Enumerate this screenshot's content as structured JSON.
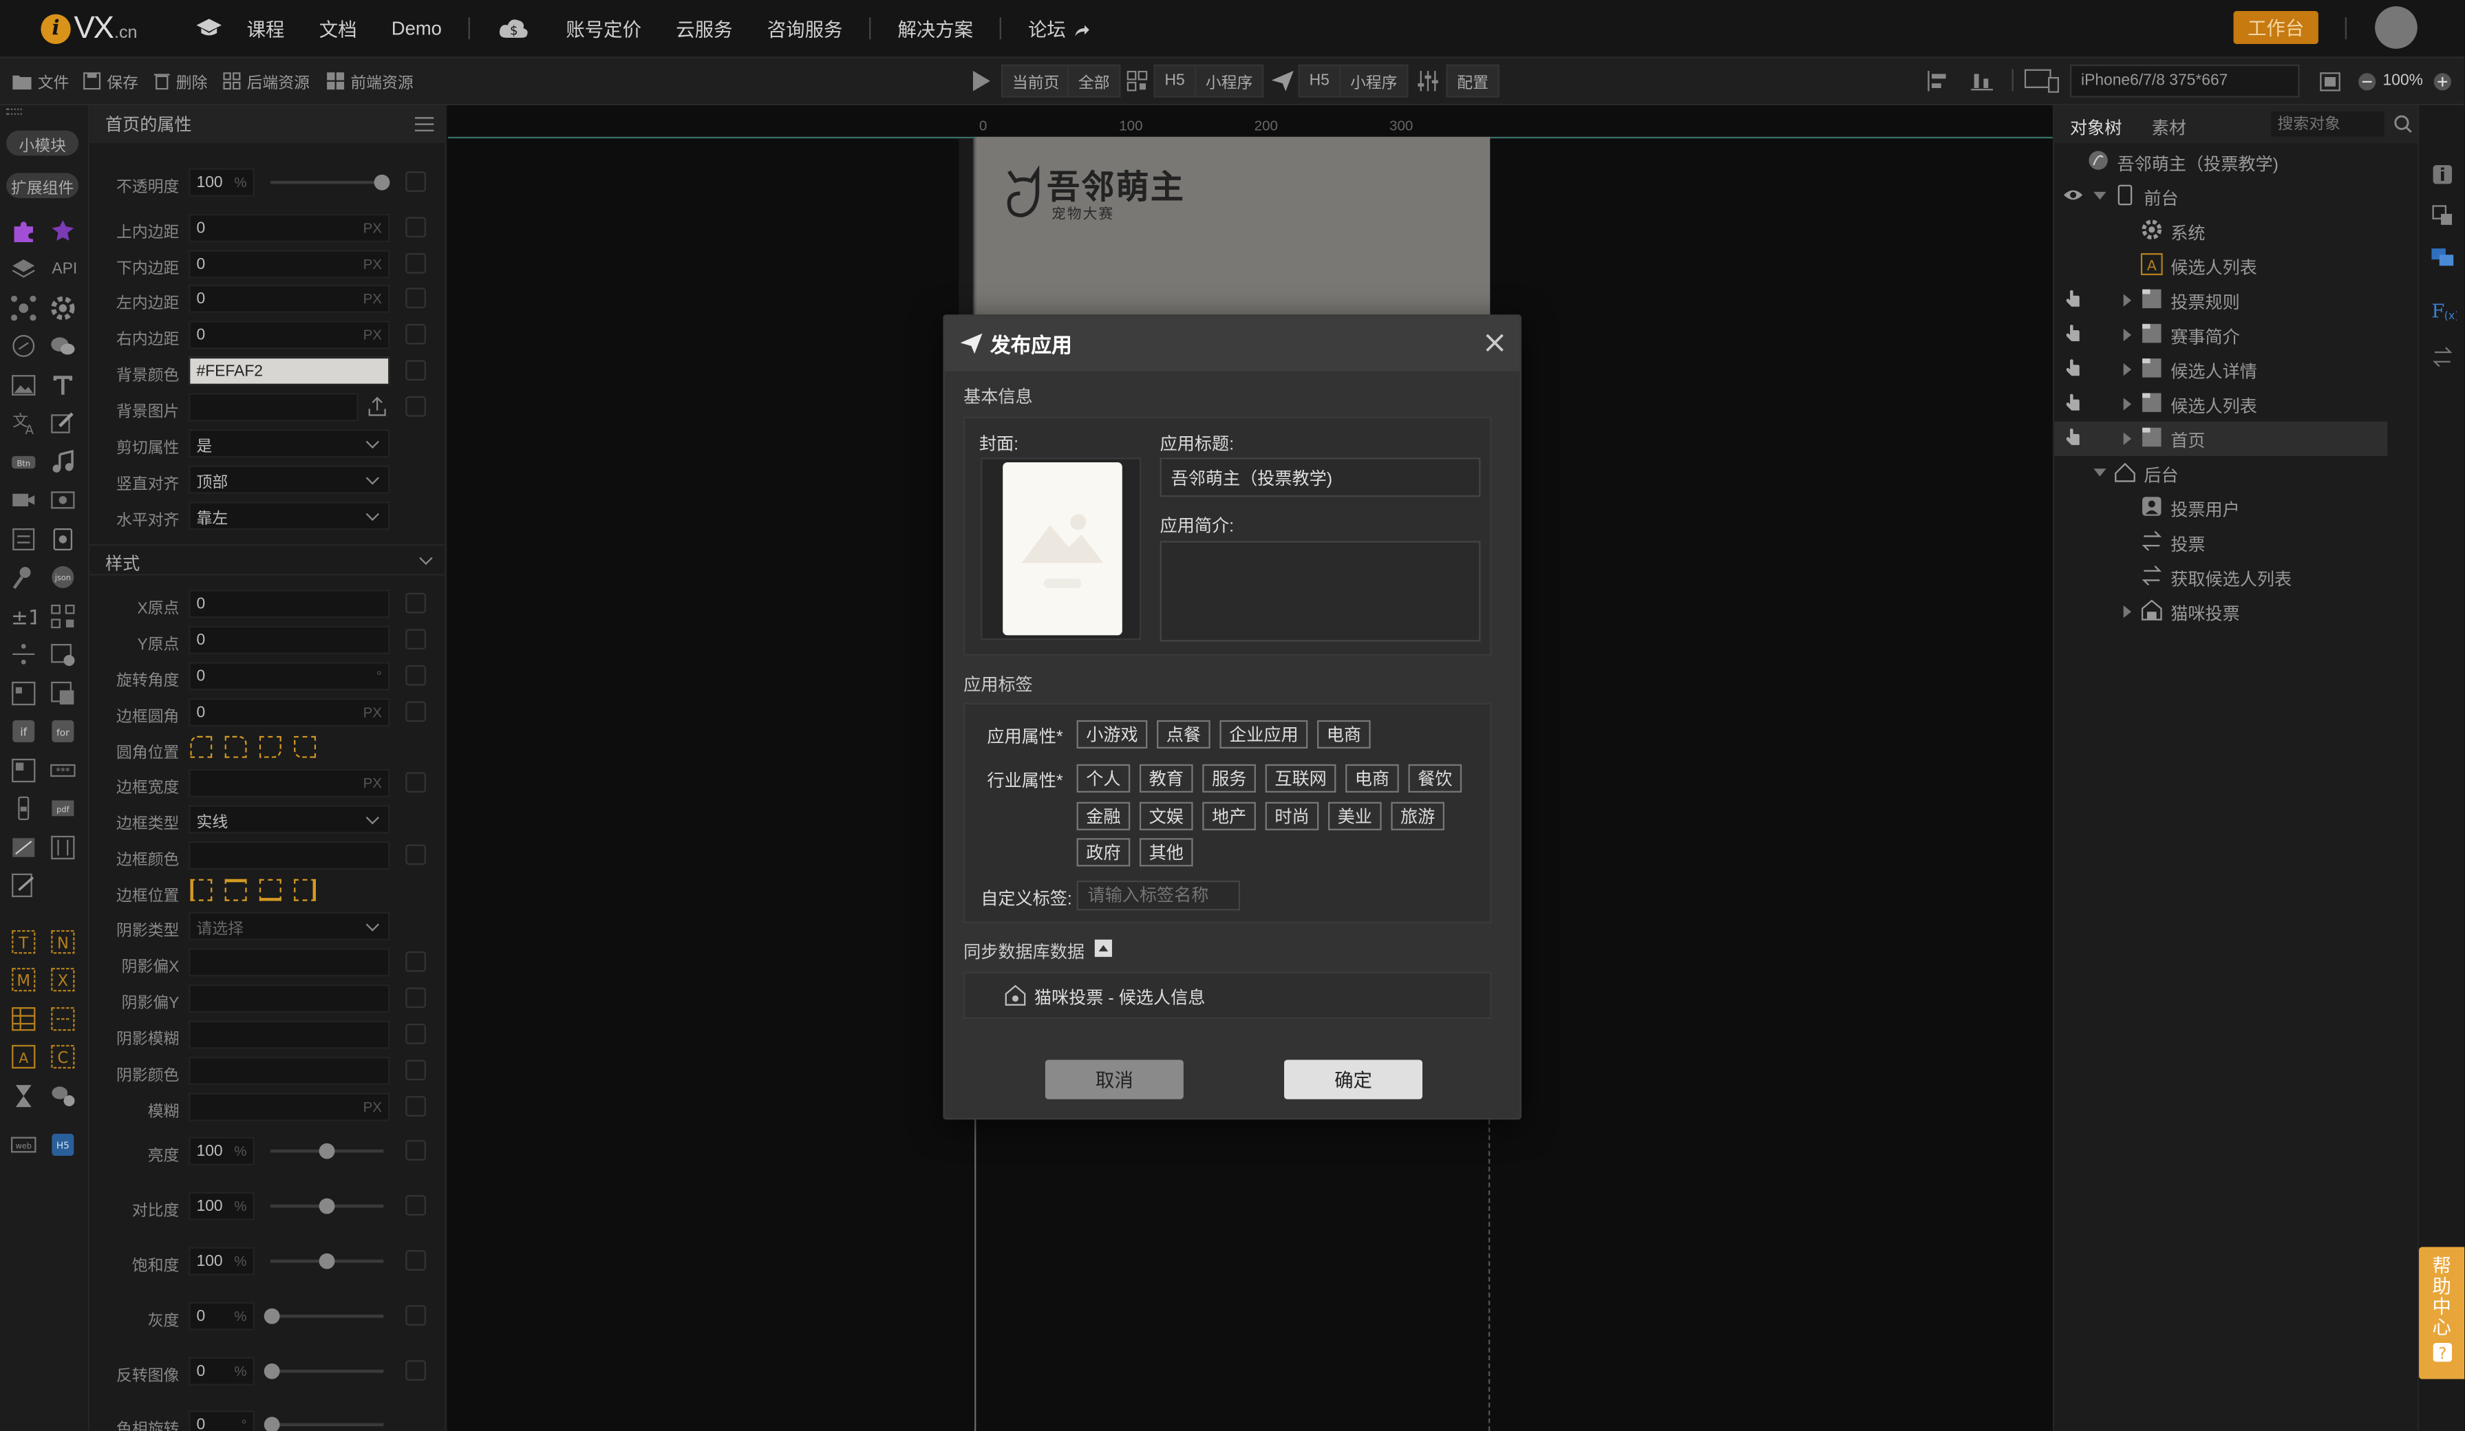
{
  "brand": {
    "i": "i",
    "vx": "VX",
    "cn": ".cn"
  },
  "topnav": {
    "items": [
      "课程",
      "文档",
      "Demo",
      "账号定价",
      "云服务",
      "咨询服务",
      "解决方案",
      "论坛"
    ],
    "workbench": "工作台"
  },
  "toolbar": {
    "file": "文件",
    "save": "保存",
    "delete": "删除",
    "backend": "后端资源",
    "frontend": "前端资源",
    "current_page": "当前页",
    "all": "全部",
    "h5": "H5",
    "mini": "小程序",
    "h5b": "H5",
    "minib": "小程序",
    "config": "配置",
    "device": "iPhone6/7/8 375*667",
    "zoom": "100%"
  },
  "leftstrip": {
    "small_module": "小模块",
    "ext": "扩展组件",
    "api": "API"
  },
  "props": {
    "header": "首页的属性",
    "opacity_label": "不透明度",
    "opacity_value": "100",
    "pct": "%",
    "pad_top": "上内边距",
    "pad_bottom": "下内边距",
    "pad_left": "左内边距",
    "pad_right": "右内边距",
    "zero": "0",
    "px": "PX",
    "bg_color_label": "背景颜色",
    "bg_color": "#FEFAF2",
    "bg_image_label": "背景图片",
    "clip_label": "剪切属性",
    "clip_value": "是",
    "valign_label": "竖直对齐",
    "valign_value": "顶部",
    "halign_label": "水平对齐",
    "halign_value": "靠左",
    "style_section": "样式",
    "x_origin": "X原点",
    "y_origin": "Y原点",
    "rotate": "旋转角度",
    "deg": "°",
    "radius": "边框圆角",
    "radius_pos": "圆角位置",
    "border_width": "边框宽度",
    "border_type": "边框类型",
    "border_type_value": "实线",
    "border_color": "边框颜色",
    "border_pos": "边框位置",
    "shadow_type": "阴影类型",
    "shadow_type_value": "请选择",
    "shadow_x": "阴影偏X",
    "shadow_y": "阴影偏Y",
    "shadow_blur": "阴影模糊",
    "shadow_color": "阴影颜色",
    "blur": "模糊",
    "brightness": "亮度",
    "contrast": "对比度",
    "saturate": "饱和度",
    "gray": "灰度",
    "invert": "反转图像",
    "hue": "色相旋转",
    "v100": "100",
    "v0": "0"
  },
  "ruler": [
    "0",
    "100",
    "200",
    "300"
  ],
  "preview": {
    "title": "吾邻萌主",
    "subtitle": "宠物大赛"
  },
  "rightpanel": {
    "tab_tree": "对象树",
    "tab_assets": "素材",
    "search_placeholder": "搜索对象",
    "nodes": [
      "吾邻萌主（投票教学)",
      "前台",
      "系统",
      "候选人列表",
      "投票规则",
      "赛事简介",
      "候选人详情",
      "候选人列表",
      "首页",
      "后台",
      "投票用户",
      "投票",
      "获取候选人列表",
      "猫咪投票"
    ]
  },
  "help": [
    "帮",
    "助",
    "中",
    "心"
  ],
  "dialog": {
    "title": "发布应用",
    "basic_info": "基本信息",
    "cover_label": "封面:",
    "app_title_label": "应用标题:",
    "app_title_value": "吾邻萌主（投票教学)",
    "app_desc_label": "应用简介:",
    "tags_section": "应用标签",
    "app_attr_label": "应用属性*",
    "app_attr_tags": [
      "小游戏",
      "点餐",
      "企业应用",
      "电商"
    ],
    "industry_label": "行业属性*",
    "industry_row1": [
      "个人",
      "教育",
      "服务",
      "互联网",
      "电商",
      "餐饮"
    ],
    "industry_row2": [
      "金融",
      "文娱",
      "地产",
      "时尚",
      "美业",
      "旅游"
    ],
    "industry_row3": [
      "政府",
      "其他"
    ],
    "custom_tag_label": "自定义标签:",
    "custom_tag_placeholder": "请输入标签名称",
    "sync_label": "同步数据库数据",
    "sync_item": "猫咪投票 - 候选人信息",
    "cancel": "取消",
    "confirm": "确定"
  }
}
